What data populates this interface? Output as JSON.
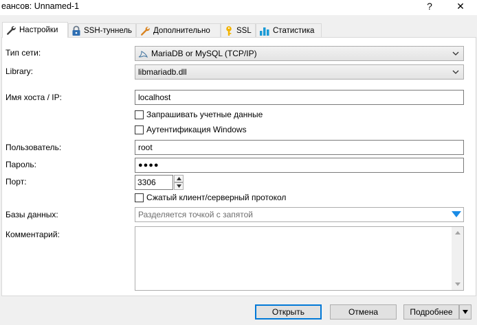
{
  "window": {
    "title": "еансов: Unnamed-1",
    "help_label": "?",
    "close_label": "✕"
  },
  "tabs": [
    {
      "label": "Настройки",
      "icon": "wrench-icon",
      "active": true
    },
    {
      "label": "SSH-туннель",
      "icon": "padlock-icon"
    },
    {
      "label": "Дополнительно",
      "icon": "wrench-orange-icon"
    },
    {
      "label": "SSL",
      "icon": "key-icon"
    },
    {
      "label": "Статистика",
      "icon": "bar-chart-icon"
    }
  ],
  "form": {
    "network_type": {
      "label": "Тип сети:",
      "value": "MariaDB or MySQL (TCP/IP)",
      "icon": "dolphin-icon"
    },
    "library": {
      "label": "Library:",
      "value": "libmariadb.dll"
    },
    "host": {
      "label": "Имя хоста / IP:",
      "value": "localhost"
    },
    "prompt_credentials": {
      "label": "Запрашивать учетные данные",
      "checked": false
    },
    "windows_auth": {
      "label": "Аутентификация Windows",
      "checked": false
    },
    "user": {
      "label": "Пользователь:",
      "value": "root"
    },
    "password": {
      "label": "Пароль:",
      "value": "●●●●"
    },
    "port": {
      "label": "Порт:",
      "value": "3306"
    },
    "compressed": {
      "label": "Сжатый клиент/серверный протокол",
      "checked": false
    },
    "databases": {
      "label": "Базы данных:",
      "placeholder": "Разделяется точкой с запятой"
    },
    "comment": {
      "label": "Комментарий:",
      "value": ""
    }
  },
  "buttons": {
    "open": "Открыть",
    "cancel": "Отмена",
    "more": "Подробнее"
  },
  "colors": {
    "accent": "#0078d7",
    "panel": "#ffffff",
    "background": "#f0f0f0"
  }
}
